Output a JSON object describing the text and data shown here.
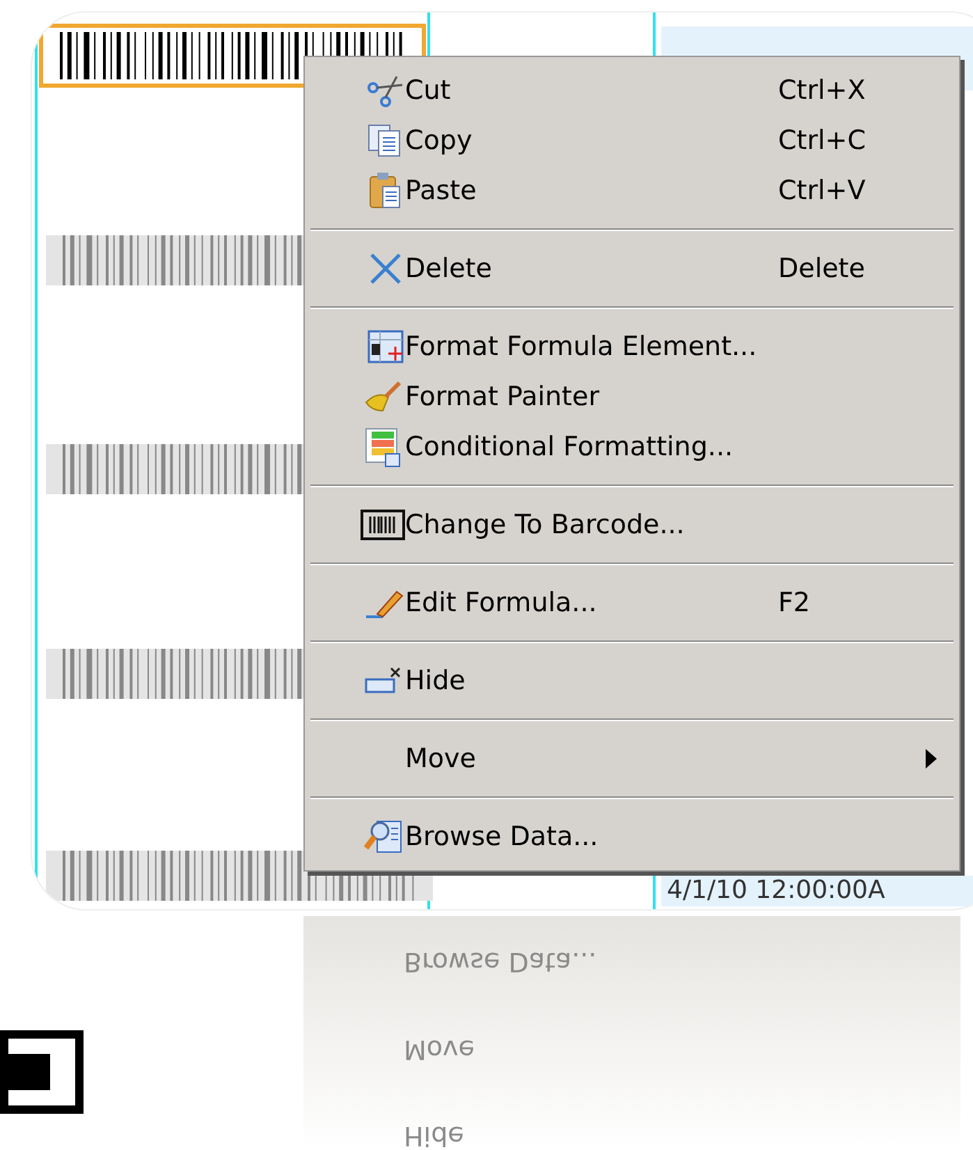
{
  "menu": {
    "items": [
      {
        "kind": "item",
        "label": "Cut",
        "shortcut": "Ctrl+X"
      },
      {
        "kind": "item",
        "label": "Copy",
        "shortcut": "Ctrl+C"
      },
      {
        "kind": "item",
        "label": "Paste",
        "shortcut": "Ctrl+V"
      },
      {
        "kind": "separator"
      },
      {
        "kind": "item",
        "label": "Delete",
        "shortcut": "Delete"
      },
      {
        "kind": "separator"
      },
      {
        "kind": "item",
        "label": "Format Formula Element..."
      },
      {
        "kind": "item",
        "label": "Format Painter"
      },
      {
        "kind": "item",
        "label": "Conditional Formatting..."
      },
      {
        "kind": "separator"
      },
      {
        "kind": "item",
        "label": "Change To Barcode..."
      },
      {
        "kind": "separator"
      },
      {
        "kind": "item",
        "label": "Edit Formula...",
        "shortcut": "F2"
      },
      {
        "kind": "separator"
      },
      {
        "kind": "item",
        "label": "Hide"
      },
      {
        "kind": "separator"
      },
      {
        "kind": "submenu",
        "label": "Move"
      },
      {
        "kind": "separator"
      },
      {
        "kind": "item",
        "label": "Browse Data..."
      }
    ]
  },
  "date_cell": "4/1/10  12:00:00A",
  "reflection": [
    "Browse Data...",
    "Move",
    "Hide"
  ]
}
